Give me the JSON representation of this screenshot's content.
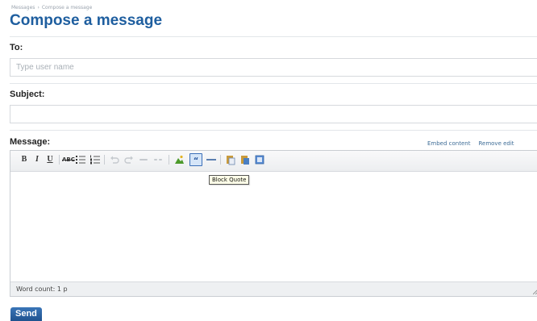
{
  "breadcrumb": {
    "items": [
      "Messages",
      "Compose a message"
    ],
    "separator": "›"
  },
  "page_title": "Compose a message",
  "to": {
    "label": "To:",
    "value": "",
    "placeholder": "Type user name"
  },
  "subject": {
    "label": "Subject:",
    "value": "",
    "placeholder": ""
  },
  "message": {
    "label": "Message:",
    "links": {
      "embed": "Embed content",
      "remove": "Remove edit"
    },
    "toolbar": {
      "bold": "B",
      "italic": "I",
      "underline": "U",
      "strike": "ABC",
      "icons": [
        "bold-icon",
        "italic-icon",
        "underline-icon",
        "strikethrough-icon",
        "unordered-list-icon",
        "ordered-list-icon",
        "undo-icon",
        "redo-icon",
        "link-icon",
        "unlink-icon",
        "image-icon",
        "block-quote-icon",
        "horizontal-rule-icon",
        "paste-icon",
        "paste-text-icon",
        "paste-word-icon"
      ],
      "active_tool": "block-quote-icon",
      "tooltip": "Block Quote"
    },
    "body": "",
    "status": "Word count: 1 p"
  },
  "send_label": "Send",
  "colors": {
    "title": "#1e5e9f",
    "link": "#3f6d97",
    "button": "#2a63a3",
    "active_tool_border": "#3b6fb8"
  }
}
